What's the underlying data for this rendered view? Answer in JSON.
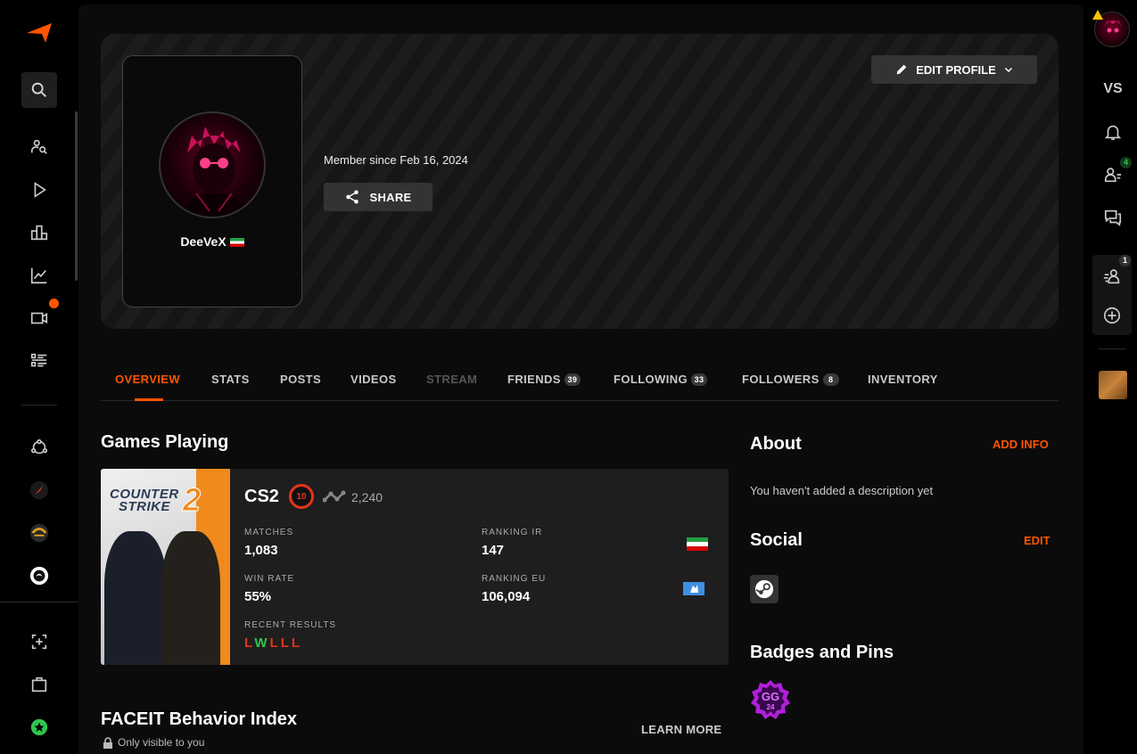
{
  "profile": {
    "username": "DeeVeX",
    "member_since": "Member since Feb 16, 2024",
    "share_label": "SHARE",
    "edit_label": "EDIT PROFILE"
  },
  "tabs": [
    {
      "label": "OVERVIEW",
      "count": null,
      "state": "active"
    },
    {
      "label": "STATS",
      "count": null,
      "state": "normal"
    },
    {
      "label": "POSTS",
      "count": null,
      "state": "normal"
    },
    {
      "label": "VIDEOS",
      "count": null,
      "state": "normal"
    },
    {
      "label": "STREAM",
      "count": null,
      "state": "disabled"
    },
    {
      "label": "FRIENDS",
      "count": "39",
      "state": "normal"
    },
    {
      "label": "FOLLOWING",
      "count": "33",
      "state": "normal"
    },
    {
      "label": "FOLLOWERS",
      "count": "8",
      "state": "normal"
    },
    {
      "label": "INVENTORY",
      "count": null,
      "state": "normal"
    }
  ],
  "games": {
    "heading": "Games Playing",
    "card": {
      "art_title_line1": "COUNTER",
      "art_title_line2": "STRIKE",
      "art_number": "2",
      "name": "CS2",
      "level": "10",
      "elo": "2,240",
      "matches_label": "MATCHES",
      "matches": "1,083",
      "win_rate_label": "WIN RATE",
      "win_rate": "55%",
      "ranking_ir_label": "RANKING IR",
      "ranking_ir": "147",
      "ranking_eu_label": "RANKING EU",
      "ranking_eu": "106,094",
      "recent_label": "RECENT RESULTS",
      "recent": [
        "L",
        "W",
        "L",
        "L",
        "L"
      ]
    }
  },
  "behavior": {
    "heading": "FACEIT Behavior Index",
    "learn_more": "LEARN MORE",
    "visibility": "Only visible to you"
  },
  "about": {
    "heading": "About",
    "add_info": "ADD INFO",
    "text": "You haven't added a description yet"
  },
  "social": {
    "heading": "Social",
    "edit": "EDIT"
  },
  "badges": {
    "heading": "Badges and Pins",
    "badge_text_top": "GG",
    "badge_text_bottom": "24"
  },
  "right_rail": {
    "vs_label": "VS",
    "friends_count": "4",
    "party_count": "1"
  },
  "colors": {
    "accent": "#ff5500",
    "win": "#30c54f",
    "loss": "#e8331c"
  }
}
